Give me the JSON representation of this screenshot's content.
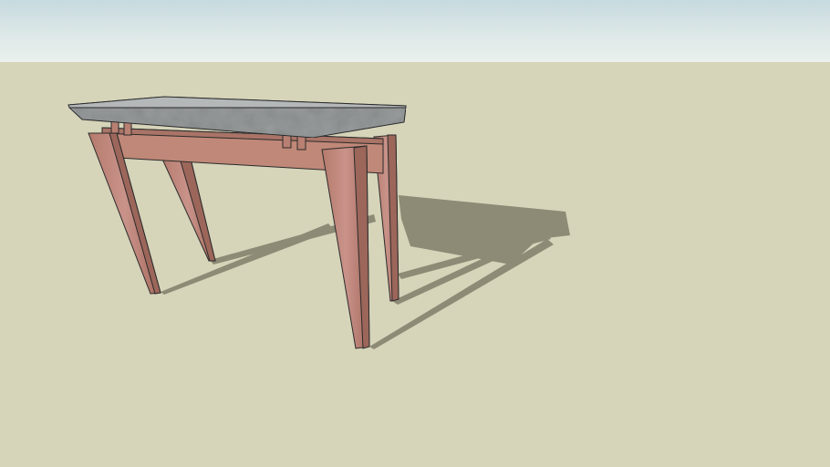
{
  "scene": {
    "sky_color": "#dfe9e8",
    "ground_color": "#d6d4b9",
    "shadow_color": "#8d8a75",
    "top_color": "#9ea2a2",
    "wood_color": "#c08878",
    "wood_dark_color": "#9c665a",
    "edge_color": "#2b2b2b"
  }
}
